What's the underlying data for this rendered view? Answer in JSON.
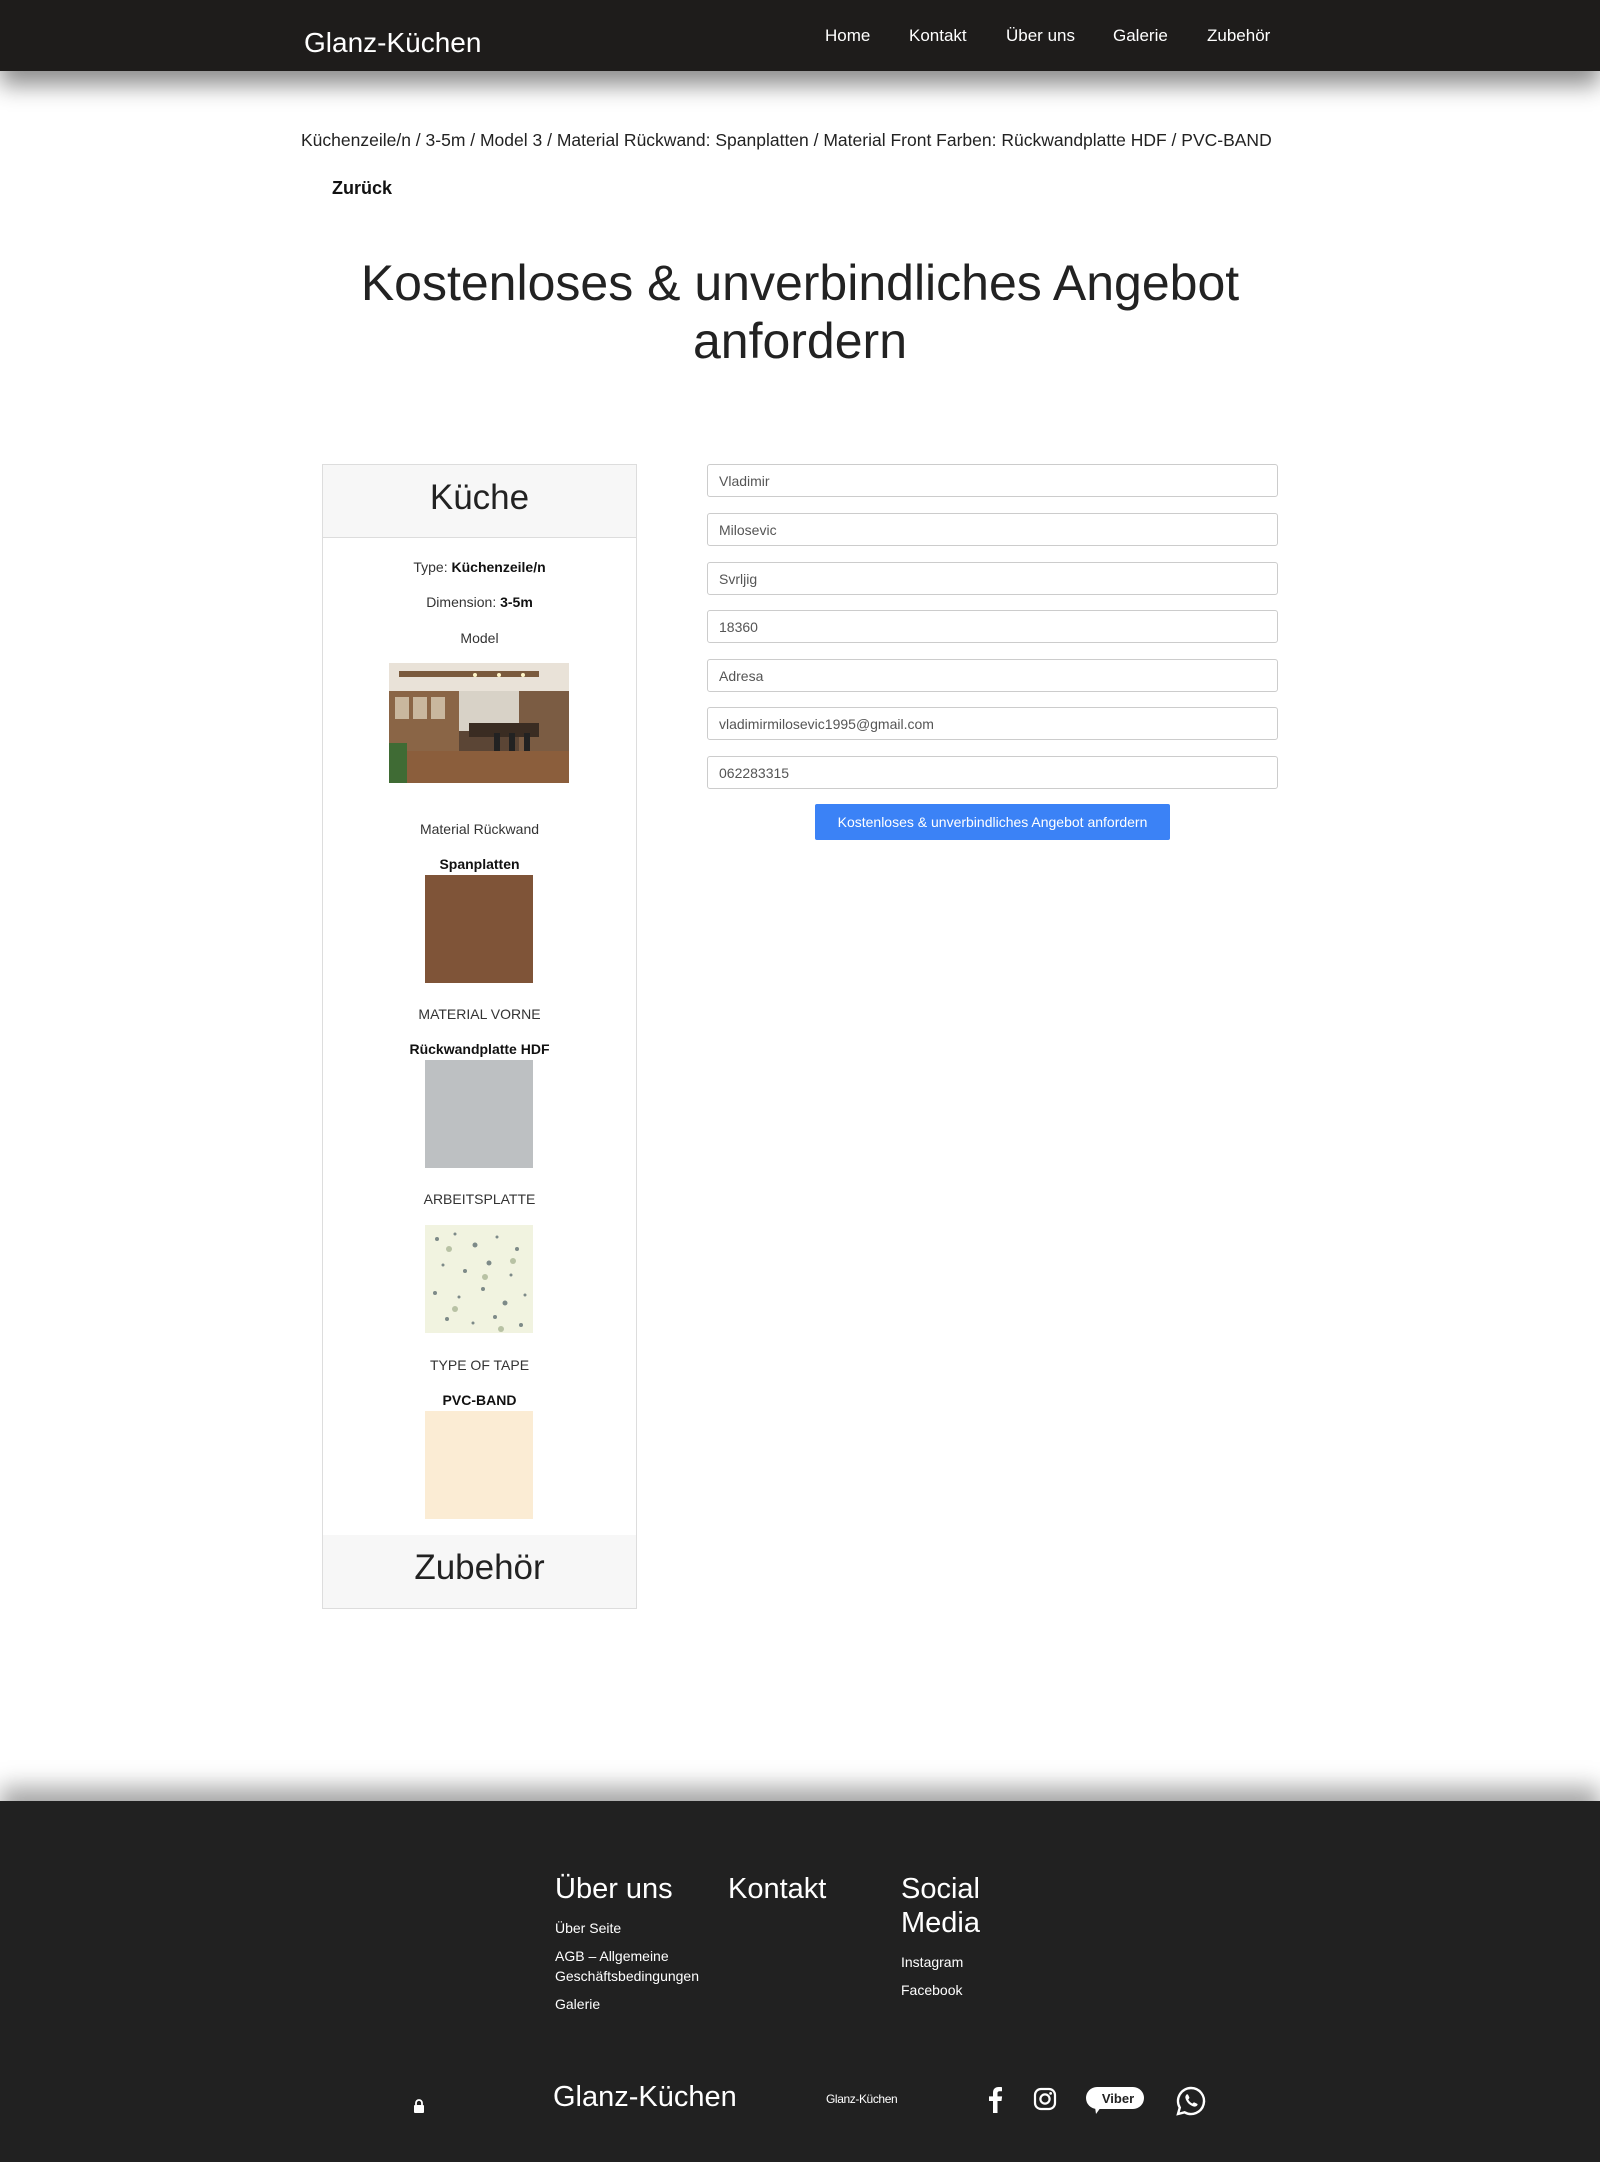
{
  "header": {
    "brand": "Glanz-Küchen",
    "nav": [
      "Home",
      "Kontakt",
      "Über uns",
      "Galerie",
      "Zubehör"
    ]
  },
  "breadcrumb": "Küchenzeile/n / 3-5m / Model 3 / Material Rückwand: Spanplatten / Material Front Farben: Rückwandplatte HDF / PVC-BAND",
  "back_label": "Zurück",
  "headline": "Kostenloses & unverbindliches Angebot anfordern",
  "card": {
    "title": "Küche",
    "type_label": "Type:",
    "type_value": "Küchenzeile/n",
    "dimension_label": "Dimension:",
    "dimension_value": "3-5m",
    "model_label": "Model",
    "rueckwand_label": "Material Rückwand",
    "rueckwand_value": "Spanplatten",
    "vorne_label": "MATERIAL VORNE",
    "vorne_value": "Rückwandplatte HDF",
    "arbeitsplatte_label": "ARBEITSPLATTE",
    "tape_label": "TYPE OF TAPE",
    "tape_value": "PVC-BAND",
    "footer": "Zubehör",
    "colors": {
      "rueckwand": "#7a5035",
      "vorne": "#bdc0c2",
      "tape": "#fbecd4"
    }
  },
  "form": {
    "fields": [
      "Vladimir",
      "Milosevic",
      "Svrljig",
      "18360",
      "Adresa",
      "vladimirmilosevic1995@gmail.com",
      "062283315"
    ],
    "submit": "Kostenloses & unverbindliches Angebot anfordern",
    "accent": "#3b82f6"
  },
  "footer": {
    "about_title": "Über uns",
    "about_links": [
      "Über Seite",
      "AGB – Allgemeine Geschäftsbedingungen",
      "Galerie"
    ],
    "contact_title": "Kontakt",
    "social_title": "Social Media",
    "social_links": [
      "Instagram",
      "Facebook"
    ],
    "brand": "Glanz-Küchen",
    "brand_small": "Glanz-Küchen",
    "icons": [
      "lock-icon",
      "facebook-icon",
      "instagram-icon",
      "viber-icon",
      "whatsapp-icon"
    ],
    "viber_label": "Viber"
  }
}
